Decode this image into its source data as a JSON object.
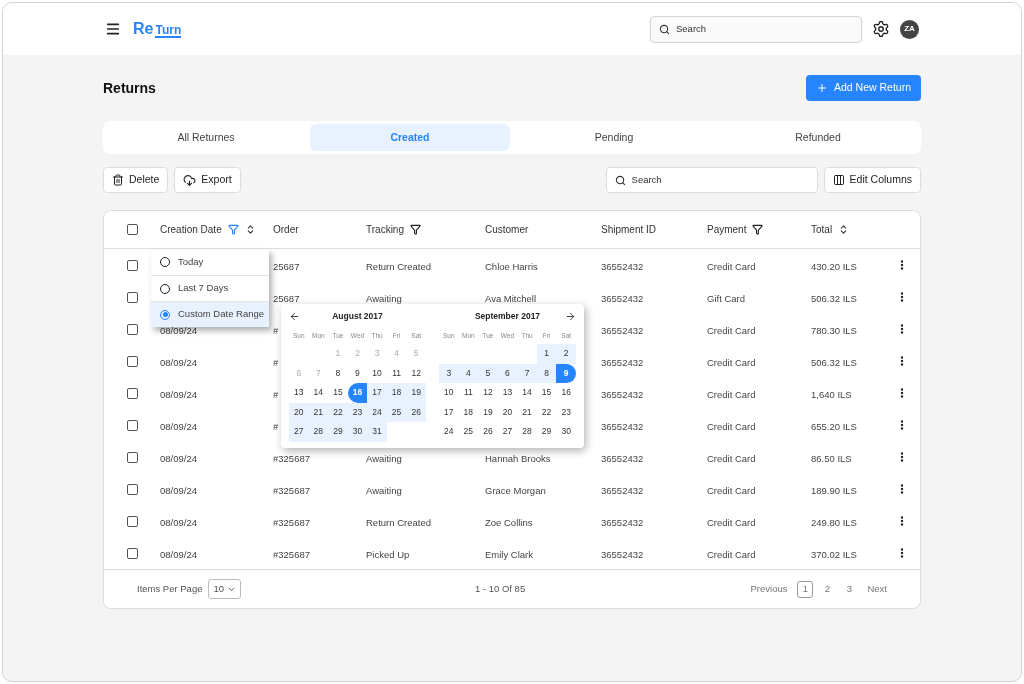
{
  "header": {
    "logo": [
      "Re",
      "Turn"
    ],
    "search": {
      "placeholder": "Search"
    },
    "avatar": "ZA"
  },
  "page_title": "Returns",
  "add_button": "Add New Return",
  "tabs": [
    {
      "label": "All Returnes",
      "selected": false
    },
    {
      "label": "Created",
      "selected": true
    },
    {
      "label": "Pending",
      "selected": false
    },
    {
      "label": "Refunded",
      "selected": false
    }
  ],
  "toolbar": {
    "delete": "Delete",
    "export": "Export",
    "search": {
      "placeholder": "Search"
    },
    "edit_columns": "Edit Columns"
  },
  "table": {
    "select_all_checked": false,
    "columns": [
      {
        "label": "Creation Date",
        "kind": "active-filter-sort"
      },
      {
        "label": "Order",
        "kind": "plain"
      },
      {
        "label": "Tracking",
        "kind": "filter"
      },
      {
        "label": "Customer",
        "kind": "plain"
      },
      {
        "label": "Shipment ID",
        "kind": "plain"
      },
      {
        "label": "Payment",
        "kind": "filter"
      },
      {
        "label": "Total",
        "kind": "sort"
      }
    ],
    "rows": [
      {
        "checked": false,
        "cells": [
          null,
          "25687",
          "Return Created",
          "Chloe Harris",
          "36552432",
          "Credit Card",
          "430.20 ILS"
        ]
      },
      {
        "checked": false,
        "cells": [
          null,
          "25687",
          "Awaiting",
          "Ava Mitchell",
          "36552432",
          "Gift Card",
          "506.32 ILS"
        ]
      },
      {
        "checked": false,
        "cells": [
          "08/09/24",
          "#",
          null,
          null,
          "36552432",
          "Credit Card",
          "780.30 ILS"
        ]
      },
      {
        "checked": false,
        "cells": [
          "08/09/24",
          "#",
          null,
          null,
          "36552432",
          "Credit Card",
          "506.32 ILS"
        ]
      },
      {
        "checked": false,
        "cells": [
          "08/09/24",
          "#",
          null,
          null,
          "36552432",
          "Credit Card",
          "1,640 ILS"
        ]
      },
      {
        "checked": false,
        "cells": [
          "08/09/24",
          "#",
          null,
          null,
          "36552432",
          "Credit Card",
          "655.20 ILS"
        ]
      },
      {
        "checked": false,
        "cells": [
          "08/09/24",
          "#325687",
          "Awaiting",
          "Hannah Brooks",
          "36552432",
          "Credit Card",
          "86.50 ILS"
        ]
      },
      {
        "checked": false,
        "cells": [
          "08/09/24",
          "#325687",
          "Awaiting",
          "Grace Morgan",
          "36552432",
          "Credit Card",
          "189.90 ILS"
        ]
      },
      {
        "checked": false,
        "cells": [
          "08/09/24",
          "#325687",
          "Return Created",
          "Zoe Collins",
          "36552432",
          "Credit Card",
          "249.80 ILS"
        ]
      },
      {
        "checked": false,
        "cells": [
          "08/09/24",
          "#325687",
          "Picked Up",
          "Emily Clark",
          "36552432",
          "Credit Card",
          "370.02 ILS"
        ]
      }
    ]
  },
  "date_filter_menu": [
    {
      "label": "Today",
      "selected": false
    },
    {
      "label": "Last 7 Days",
      "selected": false
    },
    {
      "label": "Custom Date Range",
      "selected": true
    }
  ],
  "calendar": [
    {
      "title": "August 2017",
      "weekdays": [
        "Sun",
        "Mon",
        "Tue",
        "Wed",
        "Thu",
        "Fri",
        "Sat"
      ],
      "weeks": [
        [
          {
            "label": "1",
            "kind": "muted"
          },
          {
            "label": "2",
            "kind": "muted"
          },
          {
            "label": "3",
            "kind": "muted"
          },
          {
            "label": "4",
            "kind": "muted"
          },
          {
            "label": "5",
            "kind": "muted"
          }
        ],
        [
          {
            "label": "6",
            "kind": "muted"
          },
          {
            "label": "7",
            "kind": "muted"
          },
          {
            "label": "8",
            "kind": "normal"
          },
          {
            "label": "9",
            "kind": "normal"
          },
          {
            "label": "10",
            "kind": "normal"
          },
          {
            "label": "11",
            "kind": "normal"
          },
          {
            "label": "12",
            "kind": "normal"
          }
        ],
        [
          {
            "label": "13",
            "kind": "normal"
          },
          {
            "label": "14",
            "kind": "normal"
          },
          {
            "label": "15",
            "kind": "normal"
          },
          {
            "label": "16",
            "kind": "start"
          },
          {
            "label": "17",
            "kind": "range"
          },
          {
            "label": "18",
            "kind": "range"
          },
          {
            "label": "19",
            "kind": "range"
          }
        ],
        [
          {
            "label": "20",
            "kind": "range"
          },
          {
            "label": "21",
            "kind": "range"
          },
          {
            "label": "22",
            "kind": "range"
          },
          {
            "label": "23",
            "kind": "range"
          },
          {
            "label": "24",
            "kind": "range"
          },
          {
            "label": "25",
            "kind": "range"
          },
          {
            "label": "26",
            "kind": "range"
          }
        ],
        [
          {
            "label": "27",
            "kind": "range"
          },
          {
            "label": "28",
            "kind": "range"
          },
          {
            "label": "29",
            "kind": "range"
          },
          {
            "label": "30",
            "kind": "range"
          },
          {
            "label": "31",
            "kind": "range"
          }
        ]
      ]
    },
    {
      "title": "September 2017",
      "weekdays": [
        "Sun",
        "Mon",
        "Tue",
        "Wed",
        "Thu",
        "Fri",
        "Sat"
      ],
      "weeks": [
        [
          {
            "label": "1",
            "kind": "range"
          },
          {
            "label": "2",
            "kind": "range"
          }
        ],
        [
          {
            "label": "3",
            "kind": "range"
          },
          {
            "label": "4",
            "kind": "range"
          },
          {
            "label": "5",
            "kind": "range"
          },
          {
            "label": "6",
            "kind": "range"
          },
          {
            "label": "7",
            "kind": "range"
          },
          {
            "label": "8",
            "kind": "range"
          },
          {
            "label": "9",
            "kind": "end"
          }
        ],
        [
          {
            "label": "10",
            "kind": "normal"
          },
          {
            "label": "11",
            "kind": "normal"
          },
          {
            "label": "12",
            "kind": "normal"
          },
          {
            "label": "13",
            "kind": "normal"
          },
          {
            "label": "14",
            "kind": "normal"
          },
          {
            "label": "15",
            "kind": "normal"
          },
          {
            "label": "16",
            "kind": "normal"
          }
        ],
        [
          {
            "label": "17",
            "kind": "normal"
          },
          {
            "label": "18",
            "kind": "normal"
          },
          {
            "label": "19",
            "kind": "normal"
          },
          {
            "label": "20",
            "kind": "normal"
          },
          {
            "label": "21",
            "kind": "normal"
          },
          {
            "label": "22",
            "kind": "normal"
          },
          {
            "label": "23",
            "kind": "normal"
          }
        ],
        [
          {
            "label": "24",
            "kind": "normal"
          },
          {
            "label": "25",
            "kind": "normal"
          },
          {
            "label": "26",
            "kind": "normal"
          },
          {
            "label": "27",
            "kind": "normal"
          },
          {
            "label": "28",
            "kind": "normal"
          },
          {
            "label": "29",
            "kind": "normal"
          },
          {
            "label": "30",
            "kind": "normal"
          }
        ]
      ]
    }
  ],
  "pagination": {
    "items_per_page_label": "Items Per Page",
    "items_per_page": "10",
    "summary": "1 - 10 Of 85",
    "previous": "Previous",
    "pages": [
      {
        "label": "1",
        "selected": true
      },
      {
        "label": "2",
        "selected": false
      },
      {
        "label": "3",
        "selected": false
      }
    ],
    "next": "Next"
  }
}
